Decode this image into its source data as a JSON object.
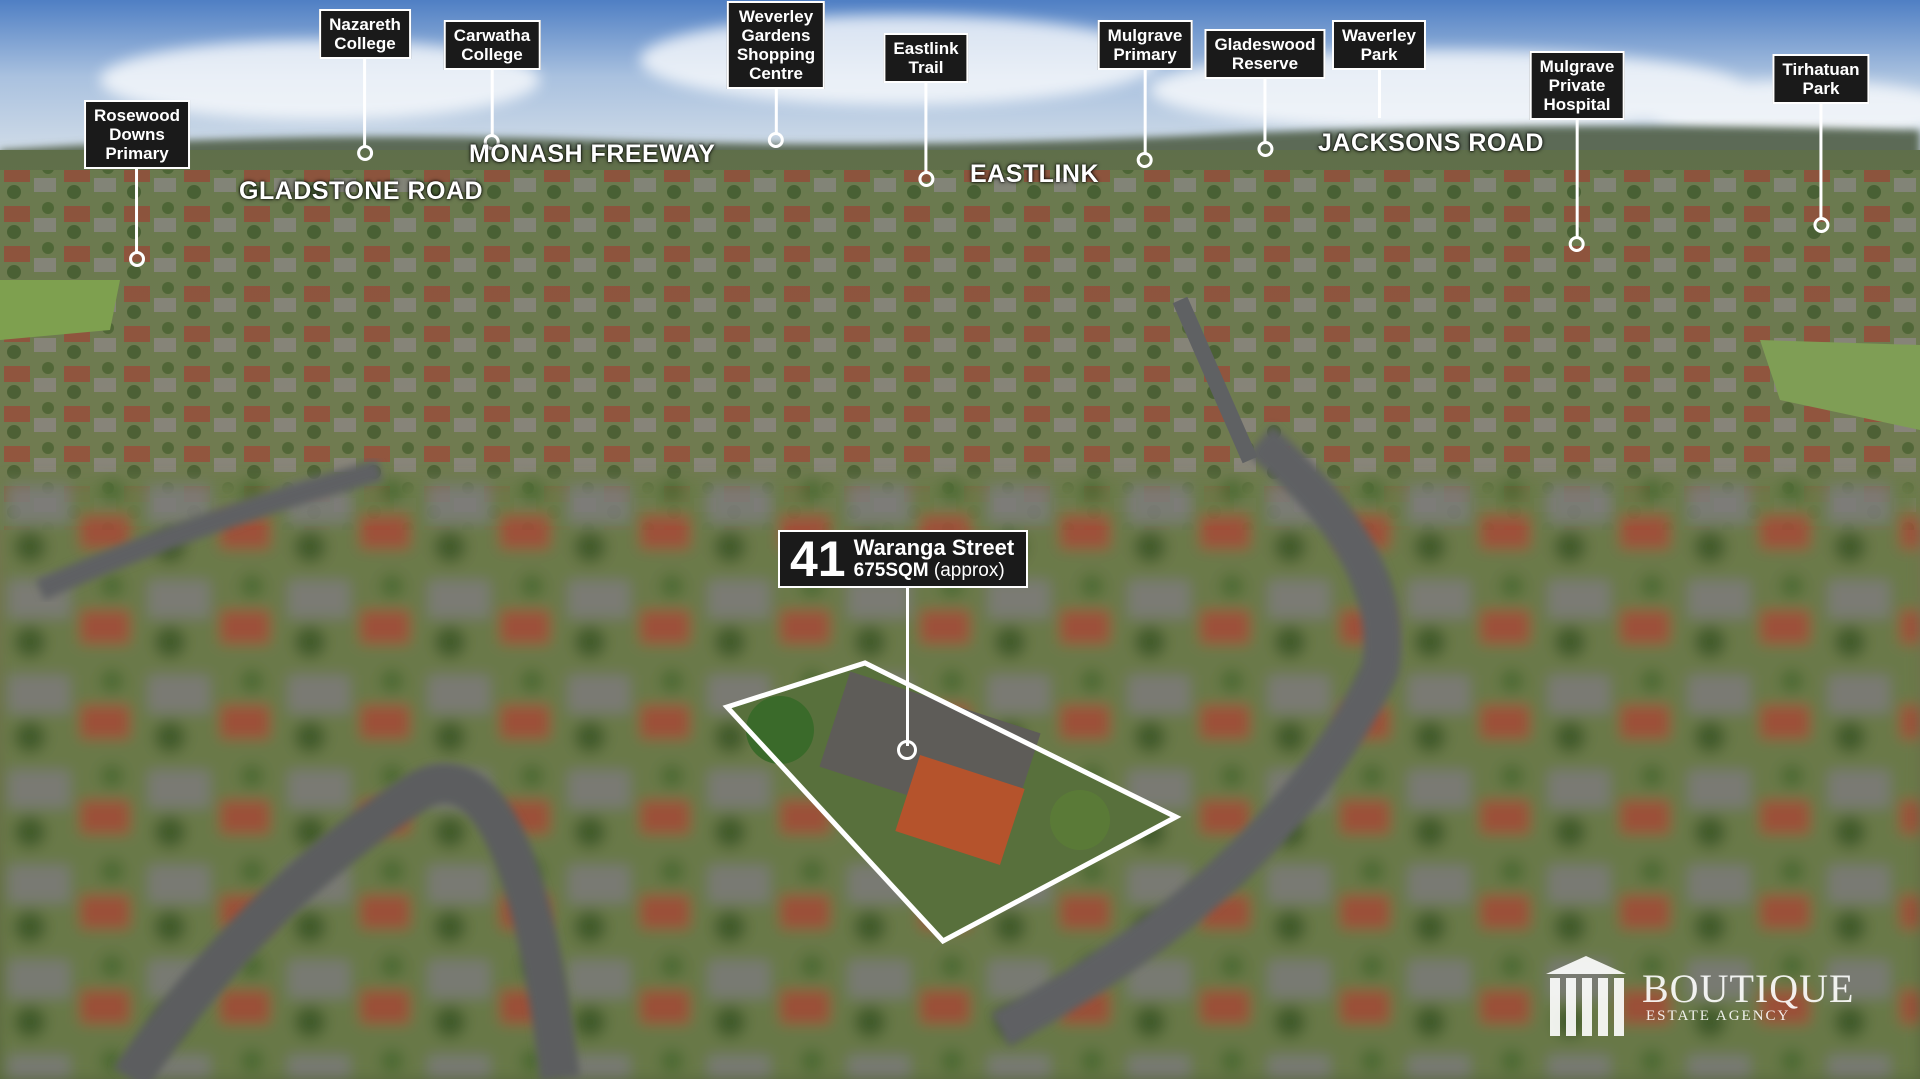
{
  "pins": [
    {
      "label": "Rosewood\nDowns\nPrimary",
      "name": "poi-rosewood-downs-primary"
    },
    {
      "label": "Nazareth\nCollege",
      "name": "poi-nazareth-college"
    },
    {
      "label": "Carwatha\nCollege",
      "name": "poi-carwatha-college"
    },
    {
      "label": "Weverley\nGardens\nShopping\nCentre",
      "name": "poi-weverley-gardens"
    },
    {
      "label": "Eastlink\nTrail",
      "name": "poi-eastlink-trail"
    },
    {
      "label": "Mulgrave\nPrimary",
      "name": "poi-mulgrave-primary"
    },
    {
      "label": "Gladeswood\nReserve",
      "name": "poi-gladeswood-reserve"
    },
    {
      "label": "Waverley\nPark",
      "name": "poi-waverley-park"
    },
    {
      "label": "Mulgrave\nPrivate\nHospital",
      "name": "poi-mulgrave-private-hospital"
    },
    {
      "label": "Tirhatuan\nPark",
      "name": "poi-tirhatuan-park"
    }
  ],
  "roads": {
    "gladstone": "GLADSTONE ROAD",
    "monash": "MONASH FREEWAY",
    "eastlink": "EASTLINK",
    "jacksons": "JACKSONS ROAD"
  },
  "property": {
    "number": "41",
    "street": "Waranga Street",
    "area_value": "675SQM",
    "area_note": "(approx)"
  },
  "brand": {
    "name": "BOUTIQUE",
    "tagline": "ESTATE AGENCY"
  },
  "colors": {
    "label_bg": "#1a1a1a",
    "label_text": "#ffffff",
    "boundary": "#ffffff"
  }
}
